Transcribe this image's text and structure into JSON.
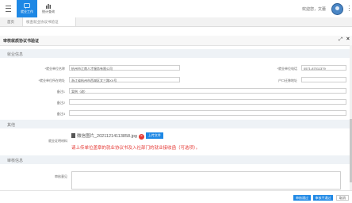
{
  "header": {
    "tabs": [
      {
        "label": "就业工作",
        "icon": "chat-icon"
      },
      {
        "label": "统计查询",
        "icon": "bar-chart-icon"
      }
    ],
    "welcome": "欢迎您，文蕾"
  },
  "page_tabs": {
    "home": "首页",
    "current": "核查就业协议书验证"
  },
  "panel": {
    "title": "审核就质协议书验证",
    "sections": {
      "employment": "就业信息",
      "other": "其他",
      "review": "审核信息"
    },
    "fields": {
      "unit_label": "*就业单位名称",
      "unit_value": "杭州市江南人才服务有限公司",
      "unit_phone_label": "*就业单位电话",
      "unit_phone_value": "0571-87011379",
      "unit_address_label": "*就业单位所在地址",
      "unit_address_value": "浙江省杭州市西湖区文三路XX号",
      "residence_label": "户口迁移地址",
      "residence_value": "",
      "note1_label": "备注1",
      "note1_value": "案例（改）",
      "note2_label": "备注2",
      "note2_value": "",
      "note3_label": "备注3",
      "note3_value": ""
    },
    "attachment": {
      "label": "就业证明材料",
      "filename": "微信图片_20211214113858.jpg",
      "upload_label": "上传文件",
      "hint": "请上传单位盖章的就业协议书及入社部门的就业接收函（可选项）。"
    },
    "review": {
      "opinion_label": "审核意见",
      "opinion_value": ""
    }
  },
  "footer": {
    "approve": "审核通过",
    "reject": "审核不通过",
    "back": "取消"
  },
  "colors": {
    "primary": "#1e88e5",
    "danger": "#e53935"
  }
}
